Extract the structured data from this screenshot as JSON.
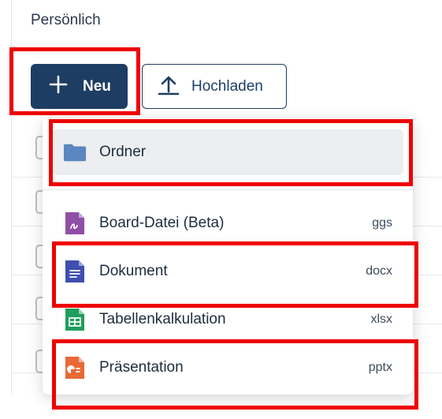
{
  "breadcrumb": {
    "title": "Persönlich"
  },
  "toolbar": {
    "new_label": "Neu",
    "upload_label": "Hochladen"
  },
  "menu": {
    "items": [
      {
        "label": "Ordner",
        "ext": ""
      },
      {
        "label": "Board-Datei (Beta)",
        "ext": "ggs"
      },
      {
        "label": "Dokument",
        "ext": "docx"
      },
      {
        "label": "Tabellenkalkulation",
        "ext": "xlsx"
      },
      {
        "label": "Präsentation",
        "ext": "pptx"
      }
    ]
  },
  "colors": {
    "primary": "#1e3d63",
    "folder": "#5b86c0",
    "board": "#8f4fa6",
    "document": "#3f4fb0",
    "spreadsheet": "#1f9e5c",
    "presentation": "#e86a35",
    "highlight": "#ee0000"
  },
  "icons": [
    "plus-icon",
    "upload-icon",
    "folder-icon",
    "board-file-icon",
    "document-icon",
    "spreadsheet-icon",
    "presentation-icon"
  ]
}
